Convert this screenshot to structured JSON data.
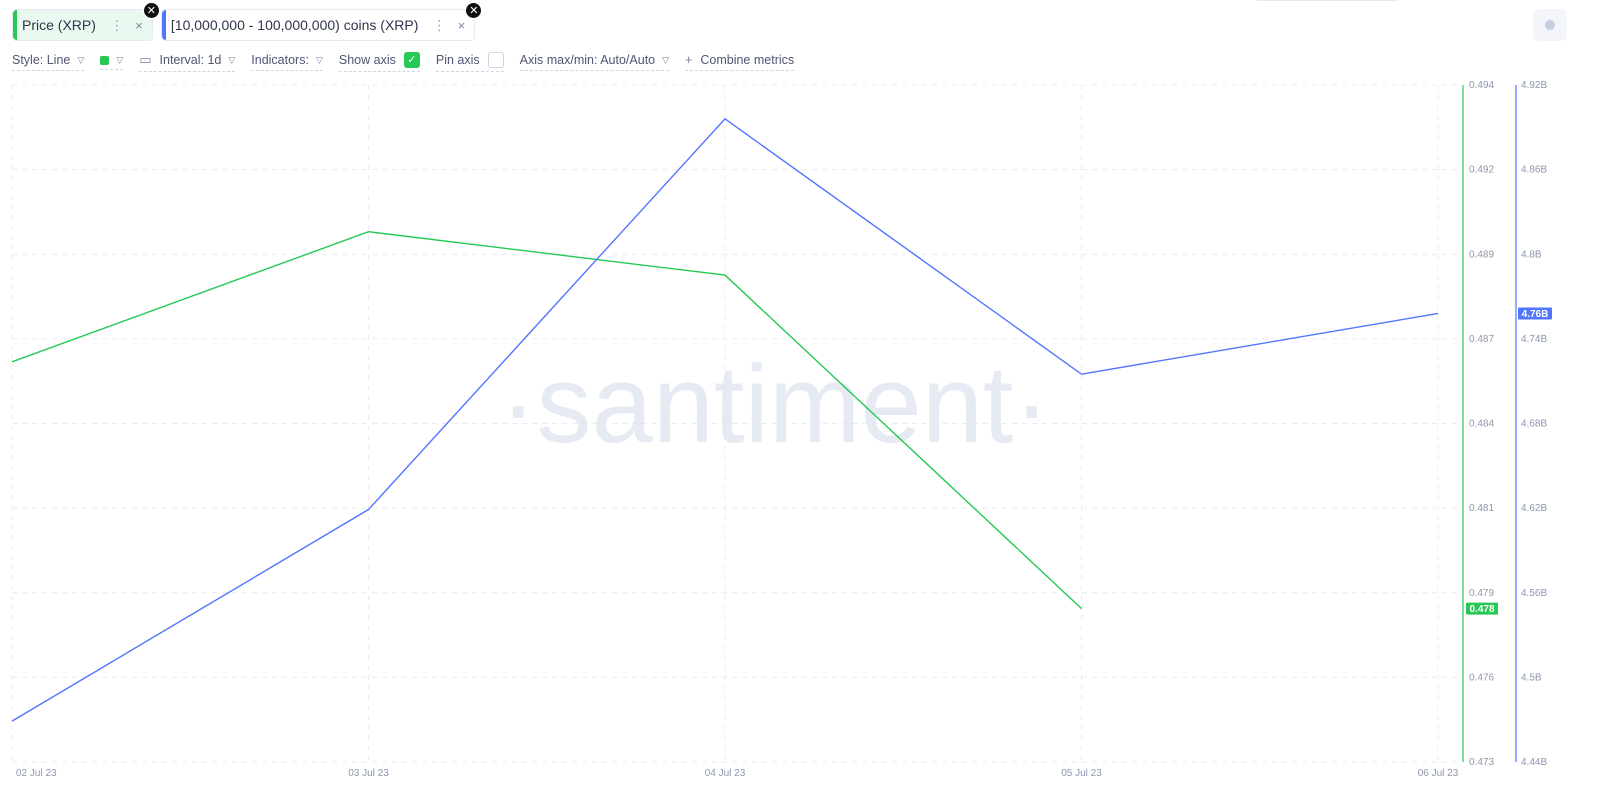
{
  "tabs": [
    {
      "label": "Price (XRP)",
      "menu": "⋮",
      "close": "×",
      "color": "#26c953"
    },
    {
      "label": "[10,000,000 - 100,000,000) coins (XRP)",
      "menu": "⋮",
      "close": "×",
      "color": "#5275ff"
    }
  ],
  "toolbar": {
    "style": "Style: Line",
    "interval": "Interval: 1d",
    "indicators": "Indicators:",
    "show_axis": "Show axis",
    "pin_axis": "Pin axis",
    "axis_maxmin": "Axis max/min: Auto/Auto",
    "combine": "Combine metrics",
    "show_axis_checked": true,
    "pin_axis_checked": false
  },
  "watermark": "·santiment·",
  "chart_data": {
    "type": "line",
    "x": [
      "02 Jul 23",
      "03 Jul 23",
      "04 Jul 23",
      "05 Jul 23",
      "06 Jul 23"
    ],
    "series": [
      {
        "name": "Price (XRP)",
        "axis": "left",
        "color": "#26c953",
        "values": [
          0.4853,
          0.4892,
          0.4879,
          0.4779,
          null
        ],
        "last_label": "0.478"
      },
      {
        "name": "[10,000,000 - 100,000,000) coins (XRP)",
        "axis": "right",
        "color": "#5275ff",
        "values": [
          4.469,
          4.619,
          4.896,
          4.715,
          4.758
        ],
        "last_label": "4.76B"
      }
    ],
    "y_left": {
      "ticks": [
        "0.494",
        "0.492",
        "0.489",
        "0.487",
        "0.484",
        "0.481",
        "0.479",
        "0.476",
        "0.473"
      ],
      "range": [
        0.4733,
        0.4936
      ]
    },
    "y_right": {
      "ticks": [
        "4.92B",
        "4.86B",
        "4.8B",
        "4.74B",
        "4.68B",
        "4.62B",
        "4.56B",
        "4.5B",
        "4.44B"
      ],
      "range": [
        4.44,
        4.92
      ]
    },
    "grid": true
  }
}
